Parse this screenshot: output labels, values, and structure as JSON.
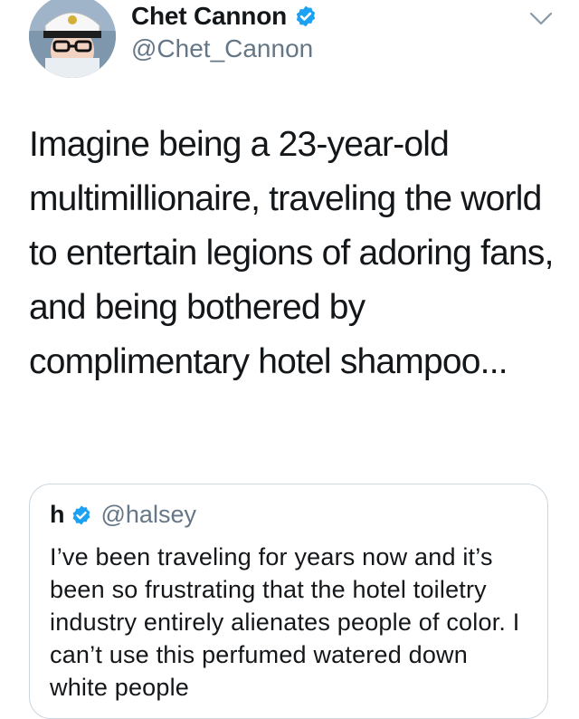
{
  "tweet": {
    "author_name": "Chet Cannon",
    "author_handle": "@Chet_Cannon",
    "text": "Imagine being a 23-year-old multimillionaire, traveling the world to entertain legions of adoring fans, and being bothered by complimentary hotel shampoo..."
  },
  "quote": {
    "author_name": "h",
    "author_handle": "@halsey",
    "text": "I’ve been traveling for years now and it’s been so frustrating that the hotel toiletry industry entirely alienates people of color. I can’t use this perfumed watered down white people"
  },
  "icons": {
    "verified": "verified-badge-icon",
    "menu": "chevron-down-icon"
  },
  "colors": {
    "verified": "#1da1f2",
    "secondary_text": "#657786",
    "border": "#ccd6dd"
  }
}
